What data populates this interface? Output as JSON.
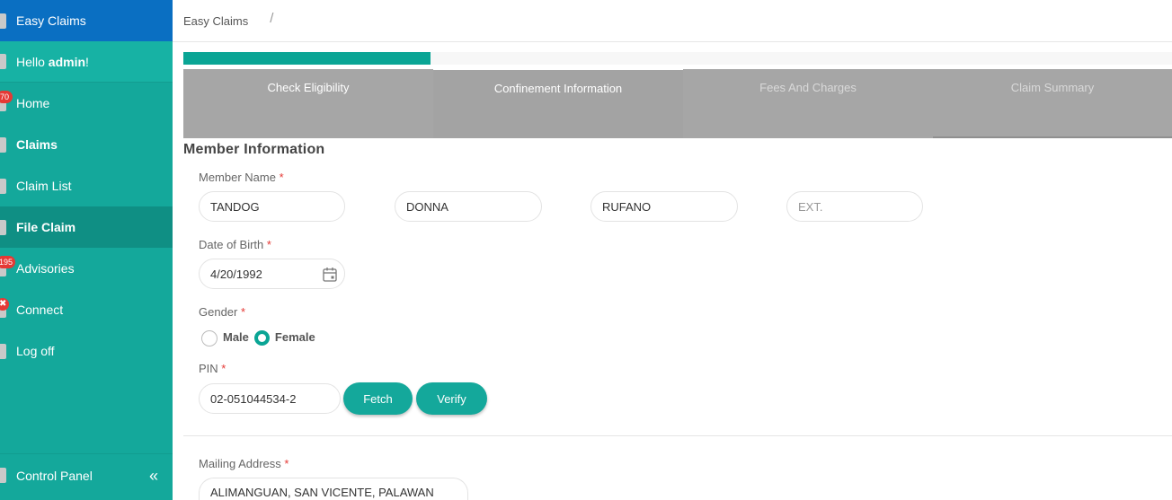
{
  "sidebar": {
    "brand": "Easy Claims",
    "hello_prefix": "Hello ",
    "hello_user": "admin",
    "hello_suffix": "!",
    "items": [
      {
        "label": "Home",
        "badge": "70"
      },
      {
        "label": "Claims"
      },
      {
        "label": "Claim List"
      },
      {
        "label": "File Claim"
      },
      {
        "label": "Advisories",
        "badge": "195"
      },
      {
        "label": "Connect",
        "badge": "✖"
      },
      {
        "label": "Log off"
      }
    ],
    "control_panel": "Control Panel",
    "collapse_glyph": "«"
  },
  "breadcrumb": {
    "root": "Easy Claims",
    "separator": "/"
  },
  "progress": {
    "fraction": 0.25,
    "color": "#0aa595"
  },
  "steps": [
    {
      "label": "Check Eligibility"
    },
    {
      "label": "Confinement Information"
    },
    {
      "label": "Fees And Charges"
    },
    {
      "label": "Claim Summary"
    }
  ],
  "form": {
    "section_title": "Member Information",
    "member_name": {
      "label": "Member Name",
      "required_mark": "*",
      "last": "TANDOG",
      "first": "DONNA",
      "middle": "RUFANO",
      "ext_placeholder": "EXT."
    },
    "dob": {
      "label": "Date of Birth",
      "required_mark": "*",
      "value": "4/20/1992"
    },
    "gender": {
      "label": "Gender",
      "required_mark": "*",
      "options": [
        "Male",
        "Female"
      ],
      "selected": "Female"
    },
    "pin": {
      "label": "PIN",
      "required_mark": "*",
      "value": "02-051044534-2",
      "fetch": "Fetch",
      "verify": "Verify"
    },
    "mailing": {
      "label": "Mailing Address",
      "required_mark": "*",
      "value": "ALIMANGUAN, SAN VICENTE, PALAWAN"
    }
  },
  "colors": {
    "brand_blue": "#0a6fc2",
    "teal": "#14a89b",
    "accent": "#0aa595",
    "badge_red": "#e53935"
  }
}
